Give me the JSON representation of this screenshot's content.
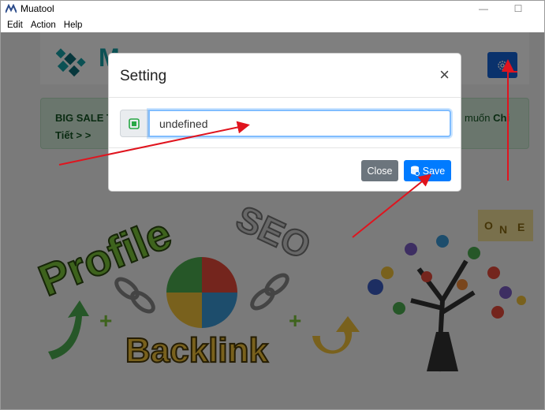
{
  "window": {
    "title": "Muatool",
    "minimize_glyph": "—",
    "maximize_glyph": "☐"
  },
  "menu": {
    "items": [
      "Edit",
      "Action",
      "Help"
    ]
  },
  "background": {
    "logo_partial": "M",
    "settings_icon": "gear-icon",
    "alert": {
      "line1": "BIG SALE T",
      "line2": "Tiết > >",
      "right_text": "muốn ",
      "right_bold": "Chi"
    },
    "graphic_words": {
      "profile": "Profile",
      "backlink": "Backlink",
      "seo": "SEO",
      "cube_letters": [
        "O",
        "N",
        "E"
      ]
    }
  },
  "modal": {
    "title": "Setting",
    "close_glyph": "×",
    "input_value": "undefined",
    "input_icon": "chip-icon",
    "buttons": {
      "close": "Close",
      "save": "Save"
    }
  },
  "colors": {
    "primary": "#007bff",
    "secondary": "#6c757d",
    "settings_button": "#1565d8",
    "alert_bg": "#d4edda",
    "annotation_arrow": "#e0141e"
  }
}
